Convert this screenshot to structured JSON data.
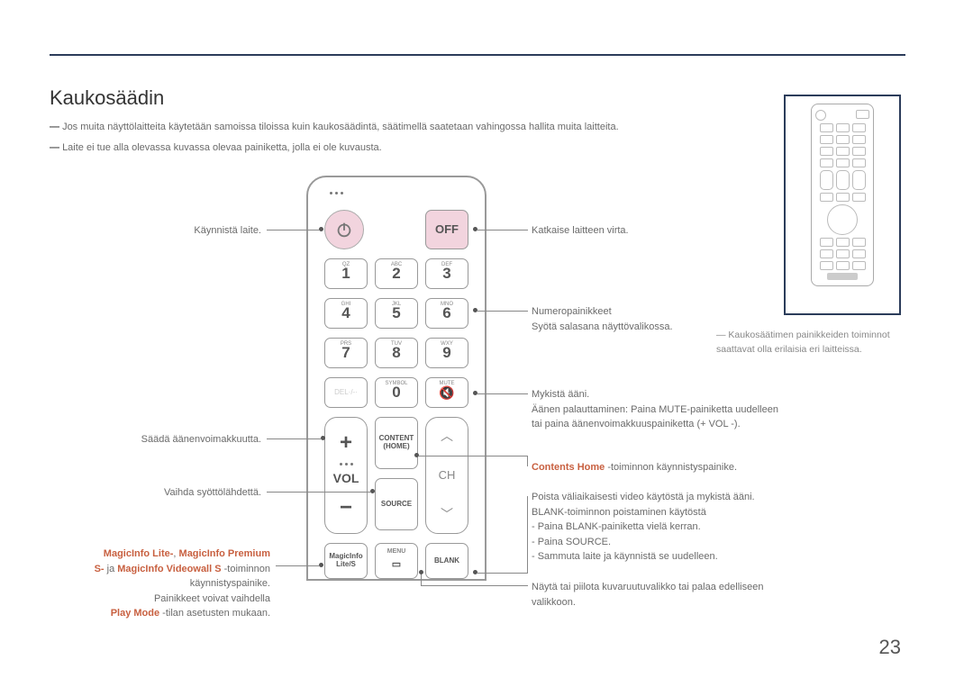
{
  "title": "Kaukosäädin",
  "notes": [
    "Jos muita näyttölaitteita käytetään samoissa tiloissa kuin kaukosäädintä, säätimellä saatetaan vahingossa hallita muita laitteita.",
    "Laite ei tue alla olevassa kuvassa olevaa painiketta, jolla ei ole kuvausta."
  ],
  "ref_note": "Kaukosäätimen painikkeiden toiminnot saattavat olla erilaisia eri laitteissa.",
  "page": "23",
  "keys": {
    "off": "OFF",
    "k1_sub": "QZ",
    "k1": "1",
    "k2_sub": "ABC",
    "k2": "2",
    "k3_sub": "DEF",
    "k3": "3",
    "k4_sub": "GHI",
    "k4": "4",
    "k5_sub": "JKL",
    "k5": "5",
    "k6_sub": "MNO",
    "k6": "6",
    "k7_sub": "PRS",
    "k7": "7",
    "k8_sub": "TUV",
    "k8": "8",
    "k9_sub": "WXY",
    "k9": "9",
    "del": "DEL·/-·",
    "sym_sub": "SYMBOL",
    "k0": "0",
    "mute": "MUTE",
    "vol": "VOL",
    "ch": "CH",
    "content_home": "CONTENT (HOME)",
    "source": "SOURCE",
    "magicinfo": "MagicInfo Lite/S",
    "menu": "MENU",
    "blank": "BLANK"
  },
  "labels": {
    "l_power": "Käynnistä laite.",
    "l_vol": "Säädä äänenvoimakkuutta.",
    "l_source": "Vaihda syöttölähdettä.",
    "l_magic_1a": "MagicInfo Lite-",
    "l_magic_1b": ", ",
    "l_magic_1c": "MagicInfo Premium",
    "l_magic_2a": "S-",
    "l_magic_2b": " ja ",
    "l_magic_2c": "MagicInfo Videowall S",
    "l_magic_2d": " -toiminnon",
    "l_magic_3": "käynnistyspainike.",
    "l_magic_4": "Painikkeet voivat vaihdella",
    "l_magic_5a": "Play Mode",
    "l_magic_5b": " -tilan asetusten mukaan.",
    "r_off": "Katkaise laitteen virta.",
    "r_num_1": "Numeropainikkeet",
    "r_num_2": "Syötä salasana näyttövalikossa.",
    "r_mute_1": "Mykistä ääni.",
    "r_mute_2": "Äänen palauttaminen: Paina MUTE-painiketta uudelleen tai paina äänenvoimakkuuspainiketta (+ VOL -).",
    "r_content_a": "Contents Home",
    "r_content_b": " -toiminnon käynnistyspainike.",
    "r_blank_1": "Poista väliaikaisesti video käytöstä ja mykistä ääni.",
    "r_blank_2": "BLANK-toiminnon poistaminen käytöstä",
    "r_blank_3": "- Paina BLANK-painiketta vielä kerran.",
    "r_blank_4": "- Paina SOURCE.",
    "r_blank_5": "- Sammuta laite ja käynnistä se uudelleen.",
    "r_menu": "Näytä tai piilota kuvaruutuvalikko tai palaa edelliseen valikkoon."
  }
}
